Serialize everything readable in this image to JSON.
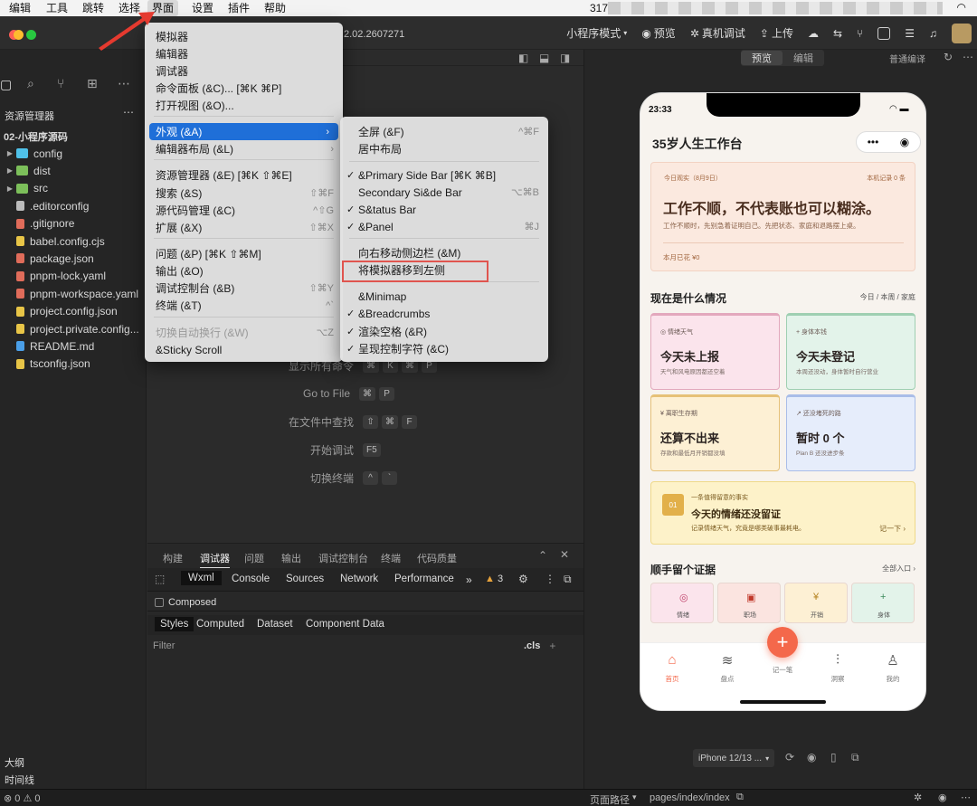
{
  "menubar": {
    "items": [
      "编辑",
      "工具",
      "跳转",
      "选择",
      "界面",
      "设置",
      "插件",
      "帮助"
    ],
    "right_text": "317"
  },
  "titlebar": {
    "version": "2.02.2607271",
    "mode": "小程序模式",
    "preview": "预览",
    "device_debug": "真机调试",
    "upload": "上传"
  },
  "sidebar": {
    "title": "资源管理器",
    "project": "02-小程序源码",
    "files": [
      "config",
      "dist",
      "src",
      ".editorconfig",
      ".gitignore",
      "babel.config.cjs",
      "package.json",
      "pnpm-lock.yaml",
      "pnpm-workspace.yaml",
      "project.config.json",
      "project.private.config...",
      "README.md",
      "tsconfig.json"
    ],
    "outline": "大纲",
    "timeline": "时间线",
    "status": "0 ⚠ 0"
  },
  "menu_main": {
    "items": [
      {
        "label": "模拟器",
        "sc": ""
      },
      {
        "label": "编辑器",
        "sc": ""
      },
      {
        "label": "调试器",
        "sc": ""
      },
      {
        "label": "命令面板 (&C)... [⌘K ⌘P]",
        "sc": ""
      },
      {
        "label": "打开视图 (&O)...",
        "sc": ""
      },
      {
        "label": "外观 (&A)",
        "sc": "›"
      },
      {
        "label": "编辑器布局 (&L)",
        "sc": "›"
      },
      {
        "label": "资源管理器 (&E) [⌘K ⇧⌘E]",
        "sc": ""
      },
      {
        "label": "搜索 (&S)",
        "sc": "⇧⌘F"
      },
      {
        "label": "源代码管理 (&C)",
        "sc": "^⇧G"
      },
      {
        "label": "扩展 (&X)",
        "sc": "⇧⌘X"
      },
      {
        "label": "问题 (&P) [⌘K ⇧⌘M]",
        "sc": ""
      },
      {
        "label": "输出 (&O)",
        "sc": ""
      },
      {
        "label": "调试控制台 (&B)",
        "sc": "⇧⌘Y"
      },
      {
        "label": "终端 (&T)",
        "sc": "^`"
      },
      {
        "label": "切换自动换行 (&W)",
        "sc": "⌥Z"
      },
      {
        "label": "&Sticky Scroll",
        "sc": ""
      }
    ]
  },
  "menu_sub": {
    "items": [
      {
        "label": "全屏 (&F)",
        "sc": "^⌘F",
        "check": false
      },
      {
        "label": "居中布局",
        "sc": "",
        "check": false
      },
      {
        "label": "&Primary Side Bar [⌘K ⌘B]",
        "sc": "",
        "check": true
      },
      {
        "label": "Secondary Si&de Bar",
        "sc": "⌥⌘B",
        "check": false
      },
      {
        "label": "S&tatus Bar",
        "sc": "",
        "check": true
      },
      {
        "label": "&Panel",
        "sc": "⌘J",
        "check": true
      },
      {
        "label": "向右移动侧边栏 (&M)",
        "sc": "",
        "check": false
      },
      {
        "label": "将模拟器移到左侧",
        "sc": "",
        "check": false
      },
      {
        "label": "&Minimap",
        "sc": "",
        "check": false
      },
      {
        "label": "&Breadcrumbs",
        "sc": "",
        "check": true
      },
      {
        "label": "渲染空格 (&R)",
        "sc": "",
        "check": true
      },
      {
        "label": "呈现控制字符 (&C)",
        "sc": "",
        "check": true
      }
    ]
  },
  "editor_hints": [
    {
      "label": "显示所有命令",
      "keys": [
        "⌘",
        "K",
        "⌘",
        "P"
      ]
    },
    {
      "label": "Go to File",
      "keys": [
        "⌘",
        "P"
      ]
    },
    {
      "label": "在文件中查找",
      "keys": [
        "⇧",
        "⌘",
        "F"
      ]
    },
    {
      "label": "开始调试",
      "keys": [
        "F5"
      ]
    },
    {
      "label": "切换终端",
      "keys": [
        "^",
        "`"
      ]
    }
  ],
  "debugger": {
    "tabs": [
      "构建",
      "调试器",
      "问题",
      "输出",
      "调试控制台",
      "终端",
      "代码质量"
    ],
    "devtabs": [
      "Wxml",
      "Console",
      "Sources",
      "Network",
      "Performance"
    ],
    "warn": "3",
    "composed": "Composed",
    "styles_tabs": [
      "Styles",
      "Computed",
      "Dataset",
      "Component Data"
    ],
    "filter": "Filter",
    "cls": ".cls"
  },
  "sim": {
    "tab_preview": "预览",
    "tab_edit": "编辑",
    "compile": "普通编译",
    "device": "iPhone 12/13 ...",
    "path_label": "页面路径",
    "path": "pages/index/index"
  },
  "phone": {
    "time": "23:33",
    "title": "35岁人生工作台",
    "hero": {
      "tag": "今日观实（8月9日）",
      "rec": "本机记录 0 条",
      "headline": "工作不顺，不代表账也可以糊涂。",
      "sub": "工作不顺时，先别急着证明自己。先把状态、家庭和退路摆上桌。",
      "spent": "本月已花 ¥0"
    },
    "sec1": {
      "title": "现在是什么情况",
      "right": "今日 / 本周 / 家庭"
    },
    "cards": [
      {
        "tag": "◎ 情绪天气",
        "big": "今天未上报",
        "small": "天气和风电原因都还空着"
      },
      {
        "tag": "+ 身体本钱",
        "big": "今天未登记",
        "small": "本周还没动，身体暂时自行营业"
      },
      {
        "tag": "¥ 离职生存期",
        "big": "还算不出来",
        "small": "存款和最低月开销都没填"
      },
      {
        "tag": "↗ 还没堵死的路",
        "big": "暂时 0 个",
        "small": "Plan B 还没进步条"
      }
    ],
    "fact": {
      "num": "01",
      "tag": "一条值得留意的事实",
      "big": "今天的情绪还没留证",
      "small": "记录情绪天气，究竟是哪类破事最耗电。",
      "link": "记一下 ›"
    },
    "sec2": {
      "title": "顺手留个证据",
      "right": "全部入口 ›"
    },
    "quick": [
      {
        "icon": "◎",
        "label": "情绪"
      },
      {
        "icon": "▣",
        "label": "职场"
      },
      {
        "icon": "¥",
        "label": "开销"
      },
      {
        "icon": "+",
        "label": "身体"
      }
    ],
    "nav": [
      "首页",
      "盘点",
      "记一笔",
      "洞察",
      "我的"
    ]
  },
  "colors": {
    "accent": "#1f6fd8",
    "phone_red": "#f4684b",
    "warn": "#e6a23c"
  }
}
